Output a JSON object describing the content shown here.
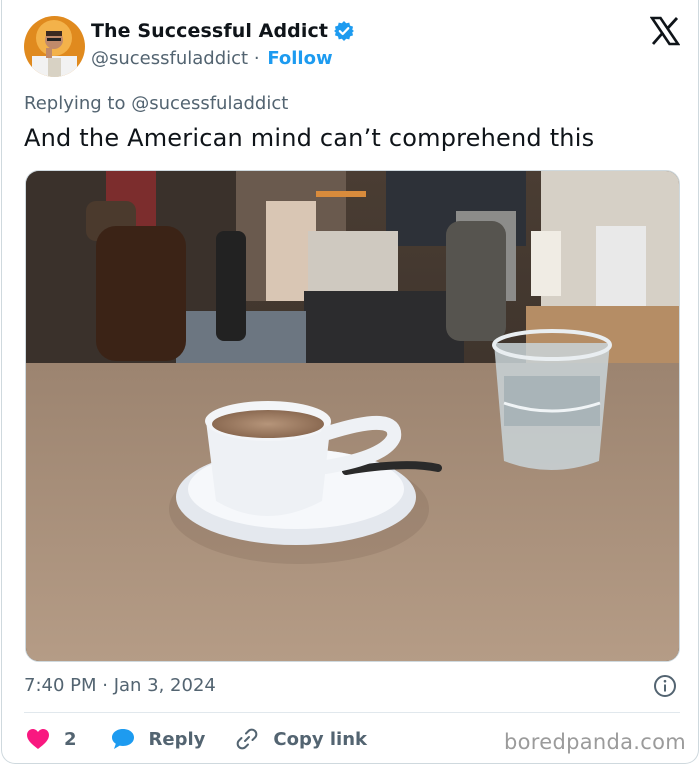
{
  "author": {
    "display_name": "The Successful Addict",
    "handle": "@sucessfuladdict",
    "separator": "·",
    "follow_label": "Follow",
    "verified": true
  },
  "reply_context": "Replying to @sucessfuladdict",
  "tweet_text": "And the American mind can’t comprehend this",
  "timestamp": "7:40 PM · Jan 3, 2024",
  "actions": {
    "like_count": "2",
    "reply_label": "Reply",
    "copy_link_label": "Copy link"
  },
  "watermark": "boredpanda.com",
  "colors": {
    "accent_blue": "#1d9bf0",
    "like_red": "#f91880",
    "secondary_text": "#536471"
  },
  "icons": {
    "verified": "verified-badge-icon",
    "logo": "x-logo-icon",
    "info": "info-icon",
    "like": "heart-icon",
    "reply": "speech-bubble-icon",
    "copy_link": "link-icon"
  }
}
